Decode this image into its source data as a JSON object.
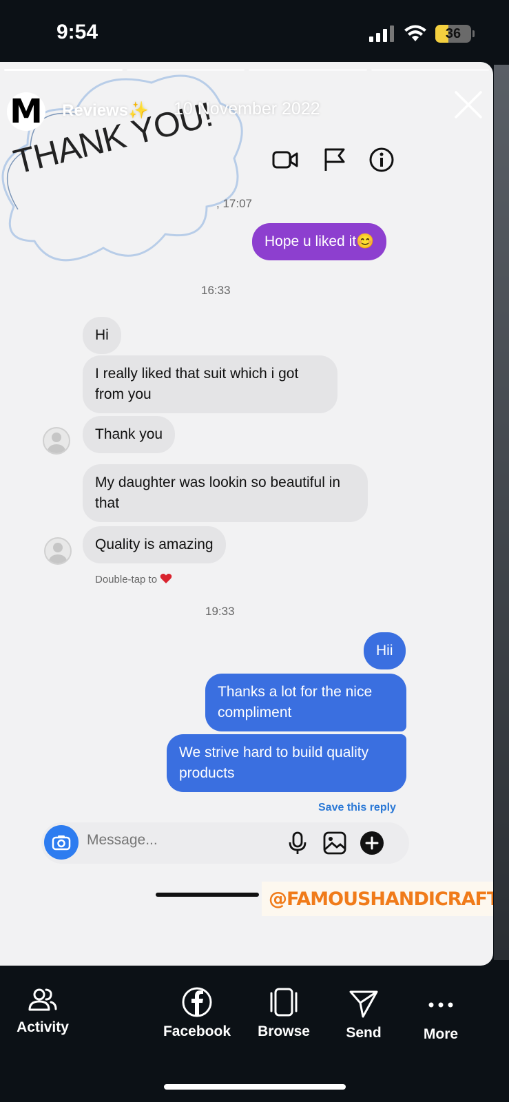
{
  "status_bar": {
    "time": "9:54",
    "battery": "36",
    "battery_level": 0.36
  },
  "story": {
    "account_initial": "M",
    "account_name": "Reviews✨",
    "date": "10 November 2022",
    "sticker_text": "THANK YOU!",
    "watermark": "@FAMOUSHANDICRAFTS.IN"
  },
  "chat": {
    "time_partial": ", 17:07",
    "msg_hope": "Hope u liked it😊",
    "time_1633": "16:33",
    "msg_hi": "Hi",
    "msg_suit": "I really liked that suit which i got from you",
    "msg_thankyou": "Thank you",
    "msg_daughter": "My daughter was lookin so beautiful in that",
    "msg_quality": "Quality is amazing",
    "double_tap": "Double-tap to",
    "time_1933": "19:33",
    "msg_hii": "Hii",
    "msg_thanks": "Thanks a lot for the nice compliment",
    "msg_strive": "We strive hard to build quality products",
    "save_reply": "Save this reply",
    "composer_placeholder": "Message..."
  },
  "bottom_nav": {
    "activity": "Activity",
    "facebook": "Facebook",
    "browse": "Browse",
    "send": "Send",
    "more": "More"
  },
  "colors": {
    "outgoing": "#3a6fe0",
    "outgoing_purple": "#8d3fcf",
    "incoming": "#e4e4e6",
    "watermark": "#f07b1a"
  }
}
